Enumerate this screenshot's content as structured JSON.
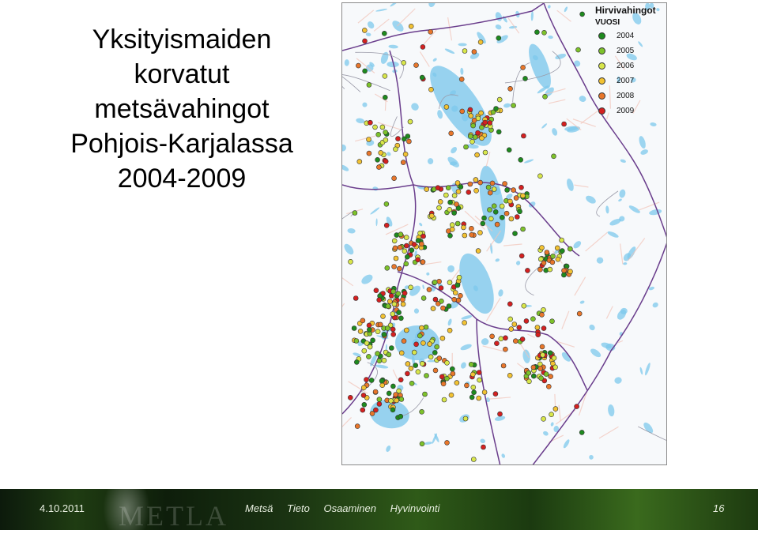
{
  "slide": {
    "title_lines": [
      "Yksityismaiden",
      "korvatut",
      "metsävahingot",
      "Pohjois-Karjalassa",
      "2004-2009"
    ]
  },
  "legend": {
    "title": "Hirvivahingot",
    "subtitle": "VUOSI",
    "items": [
      {
        "year": "2004",
        "color": "#1e8a1e"
      },
      {
        "year": "2005",
        "color": "#7dc22a"
      },
      {
        "year": "2006",
        "color": "#d8e64a"
      },
      {
        "year": "2007",
        "color": "#f2c232"
      },
      {
        "year": "2008",
        "color": "#e8762a"
      },
      {
        "year": "2009",
        "color": "#d42020"
      }
    ]
  },
  "colors": {
    "water": "#7ec8ec",
    "border": "#6a3d8c",
    "land": "#f7f9fb"
  },
  "footer": {
    "date": "4.10.2011",
    "logo": "METLA",
    "tags": [
      "Metsä",
      "Tieto",
      "Osaaminen",
      "Hyvinvointi"
    ],
    "page": "16"
  }
}
